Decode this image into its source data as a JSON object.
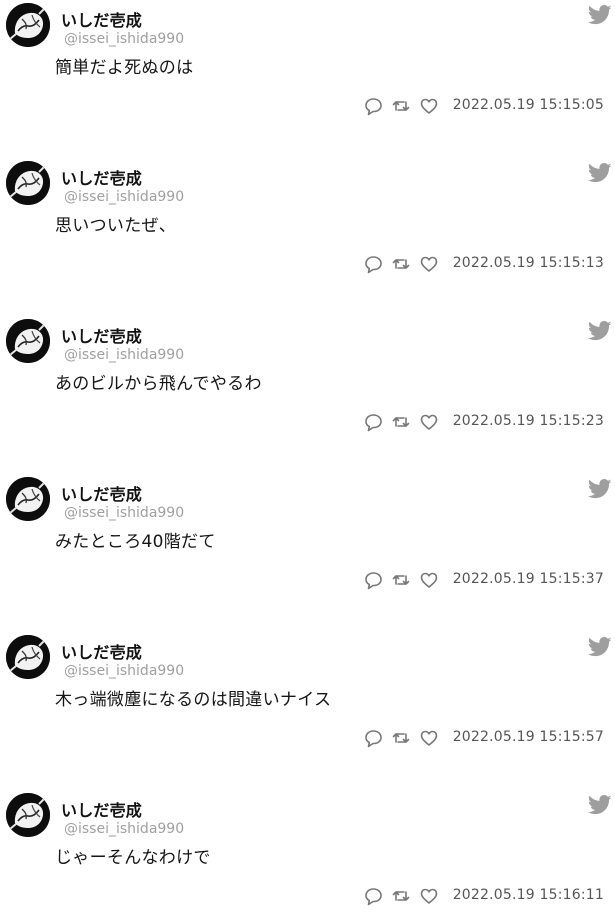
{
  "tweets": [
    {
      "author": "いしだ壱成",
      "handle": "@issei_ishida990",
      "text": "簡単だよ死ぬのは",
      "time": "2022.05.19 15:15:05"
    },
    {
      "author": "いしだ壱成",
      "handle": "@issei_ishida990",
      "text": "思いついたぜ、",
      "time": "2022.05.19 15:15:13"
    },
    {
      "author": "いしだ壱成",
      "handle": "@issei_ishida990",
      "text": "あのビルから飛んでやるわ",
      "time": "2022.05.19 15:15:23"
    },
    {
      "author": "いしだ壱成",
      "handle": "@issei_ishida990",
      "text": "みたところ40階だて",
      "time": "2022.05.19 15:15:37"
    },
    {
      "author": "いしだ壱成",
      "handle": "@issei_ishida990",
      "text": "木っ端微塵になるのは間違いナイス",
      "time": "2022.05.19 15:15:57"
    },
    {
      "author": "いしだ壱成",
      "handle": "@issei_ishida990",
      "text": "じゃーそんなわけで",
      "time": "2022.05.19 15:16:11"
    }
  ],
  "icons": {
    "brand": "bird-icon",
    "reply": "reply-icon",
    "retweet": "retweet-icon",
    "like": "heart-icon"
  },
  "colors": {
    "bird": "#9e9e9e",
    "handle": "#a0a0a0",
    "action": "#777777",
    "avatar_bg": "#0d0d0d"
  }
}
